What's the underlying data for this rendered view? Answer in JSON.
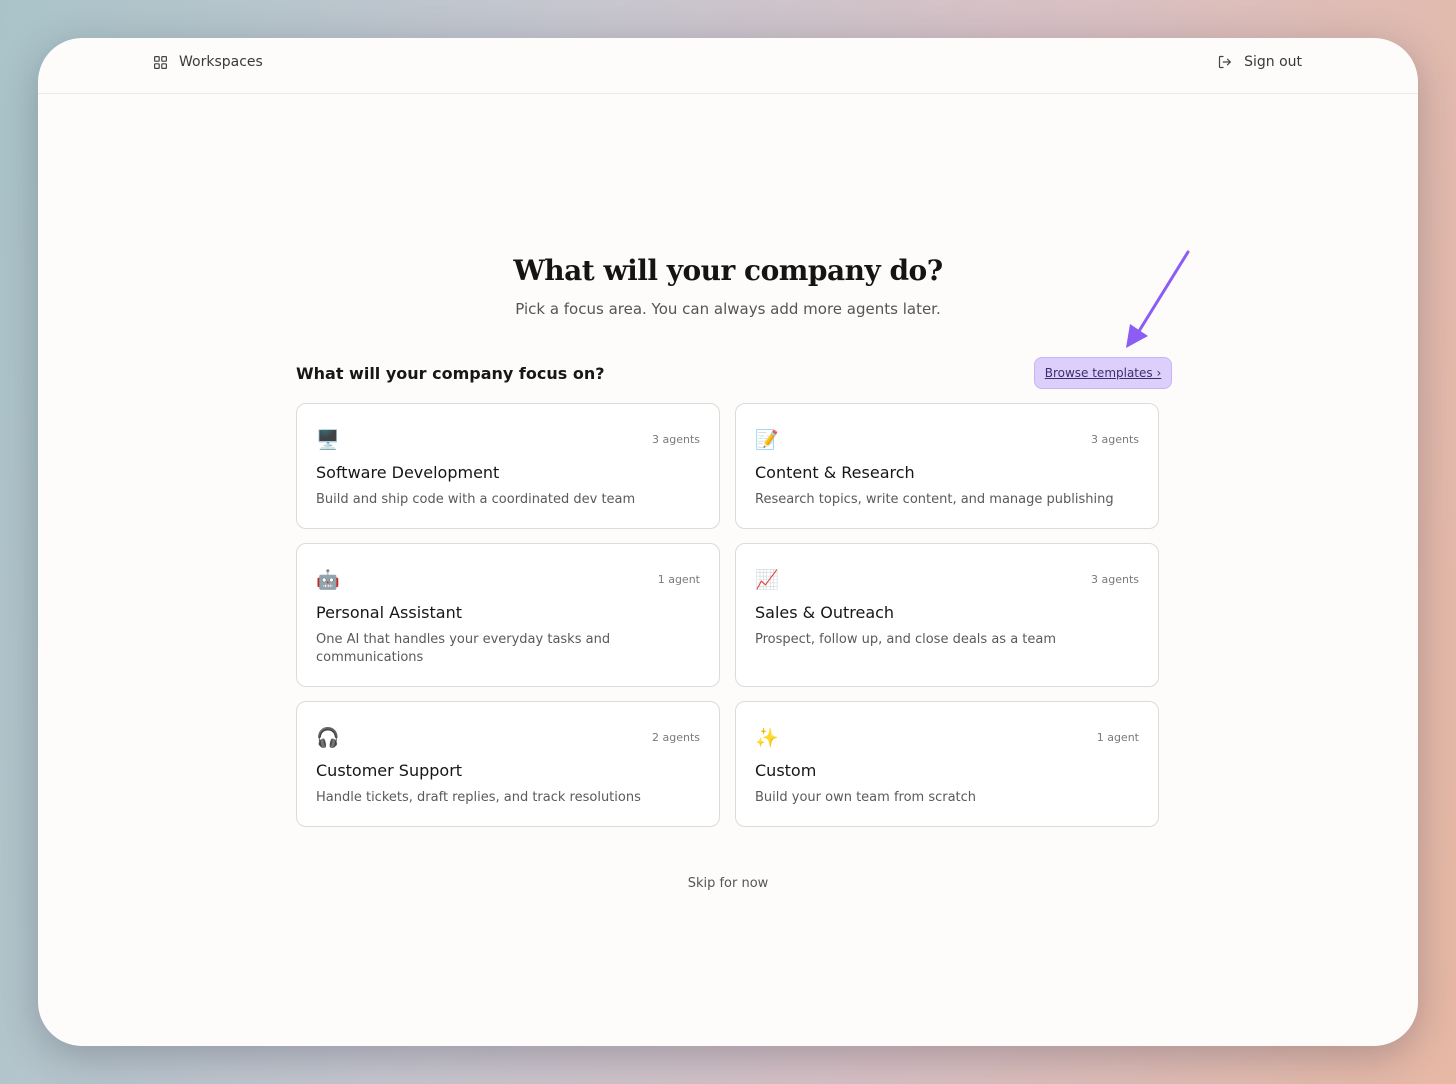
{
  "topbar": {
    "workspaces_label": "Workspaces",
    "signout_label": "Sign out"
  },
  "main": {
    "heading": "What will your company do?",
    "subheading": "Pick a focus area. You can always add more agents later.",
    "focus_label": "What will your company focus on?",
    "browse_label": "Browse templates ›",
    "skip_label": "Skip for now"
  },
  "cards": [
    {
      "emoji": "🖥️",
      "count": "3 agents",
      "title": "Software Development",
      "desc": "Build and ship code with a coordinated dev team"
    },
    {
      "emoji": "📝",
      "count": "3 agents",
      "title": "Content & Research",
      "desc": "Research topics, write content, and manage publishing"
    },
    {
      "emoji": "🤖",
      "count": "1 agent",
      "title": "Personal Assistant",
      "desc": "One AI that handles your everyday tasks and communications"
    },
    {
      "emoji": "📈",
      "count": "3 agents",
      "title": "Sales & Outreach",
      "desc": "Prospect, follow up, and close deals as a team"
    },
    {
      "emoji": "🎧",
      "count": "2 agents",
      "title": "Customer Support",
      "desc": "Handle tickets, draft replies, and track resolutions"
    },
    {
      "emoji": "✨",
      "count": "1 agent",
      "title": "Custom",
      "desc": "Build your own team from scratch"
    }
  ],
  "colors": {
    "accent": "#8b5cf6",
    "browse_bg": "#dccffc"
  }
}
